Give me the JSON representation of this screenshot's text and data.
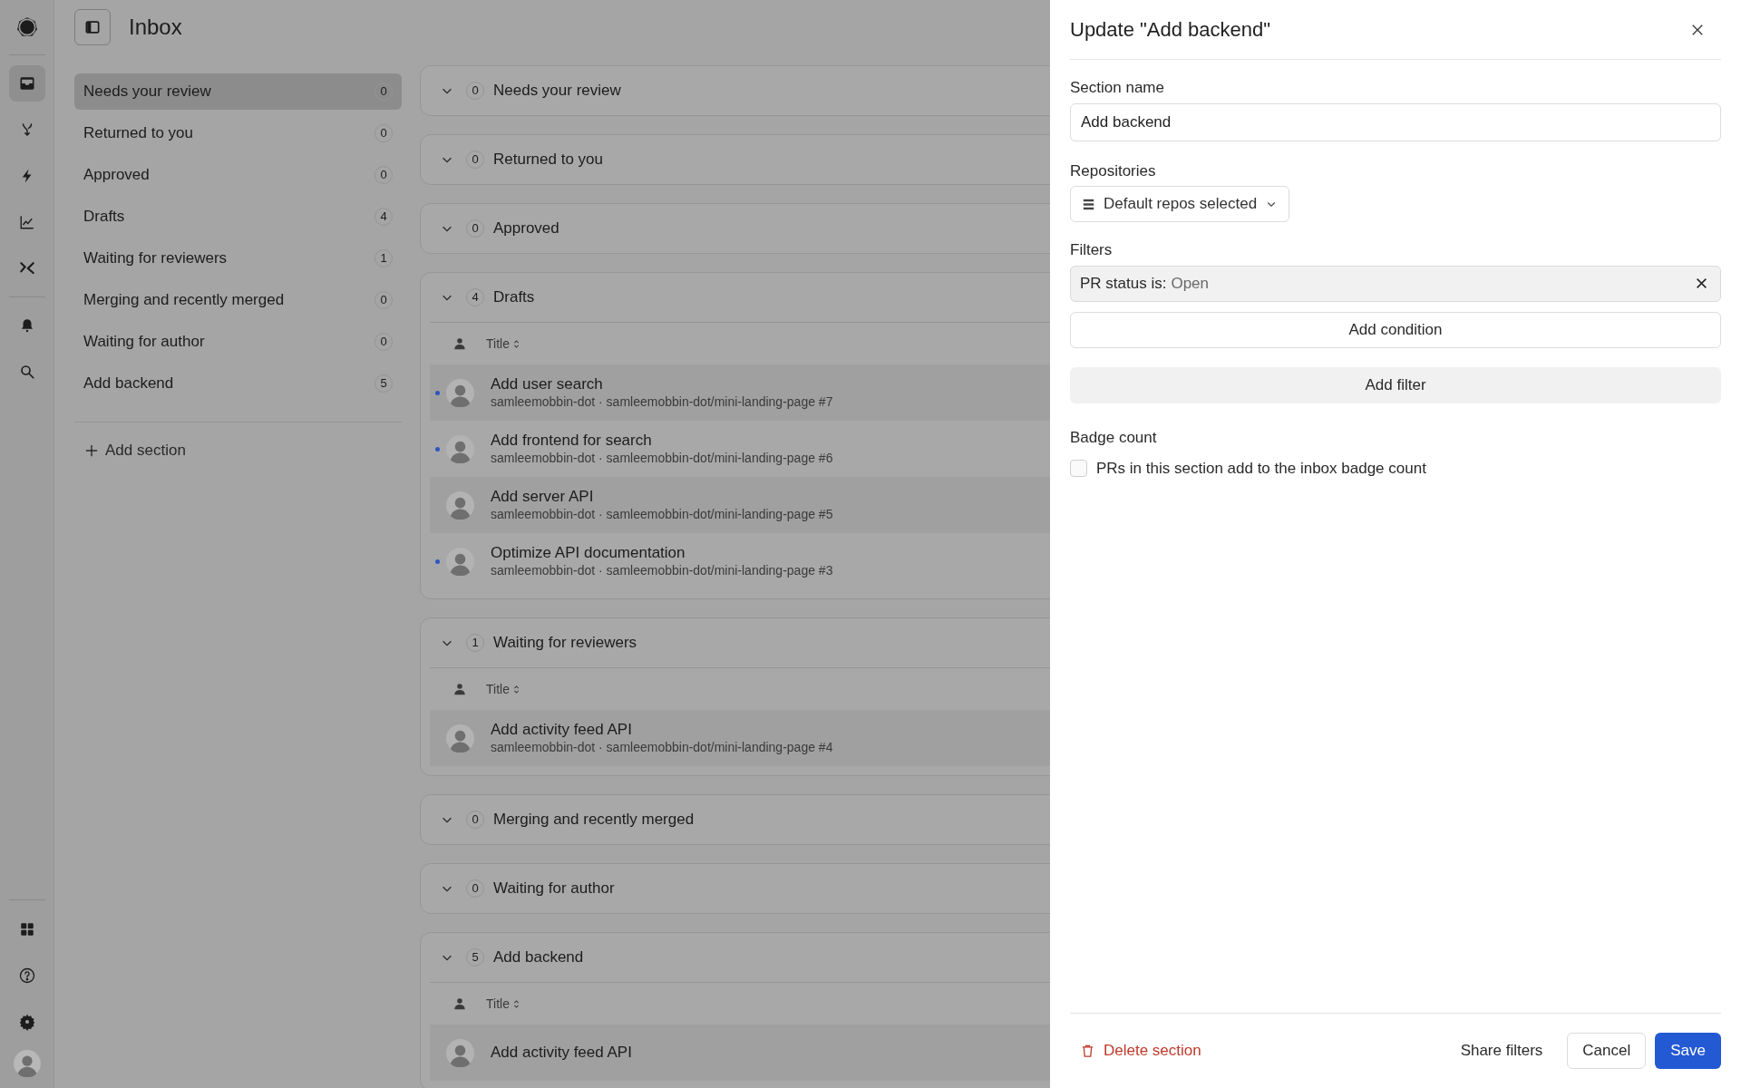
{
  "rail": {
    "top_items": [
      {
        "selected": true
      },
      {
        "selected": false
      },
      {
        "selected": false
      },
      {
        "selected": false
      },
      {
        "selected": false
      }
    ],
    "middle_items": [
      {
        "selected": false
      },
      {
        "selected": false
      }
    ],
    "bottom_items": [
      {
        "selected": false
      },
      {
        "selected": false
      },
      {
        "selected": false
      }
    ]
  },
  "header": {
    "title": "Inbox"
  },
  "sections": [
    {
      "label": "Needs your review",
      "count": "0",
      "selected": true
    },
    {
      "label": "Returned to you",
      "count": "0",
      "selected": false
    },
    {
      "label": "Approved",
      "count": "0",
      "selected": false
    },
    {
      "label": "Drafts",
      "count": "4",
      "selected": false
    },
    {
      "label": "Waiting for reviewers",
      "count": "1",
      "selected": false
    },
    {
      "label": "Merging and recently merged",
      "count": "0",
      "selected": false
    },
    {
      "label": "Waiting for author",
      "count": "0",
      "selected": false
    },
    {
      "label": "Add backend",
      "count": "5",
      "selected": false
    }
  ],
  "add_section": "Add section",
  "groups": [
    {
      "title": "Needs your review",
      "count": "0"
    },
    {
      "title": "Returned to you",
      "count": "0"
    },
    {
      "title": "Approved",
      "count": "0"
    },
    {
      "title": "Drafts",
      "count": "4",
      "column": "Title",
      "rows": [
        {
          "title": "Add user search",
          "subtitle": "samleemobbin-dot · samleemobbin-dot/mini-landing-page #7",
          "unread": true
        },
        {
          "title": "Add frontend for search",
          "subtitle": "samleemobbin-dot · samleemobbin-dot/mini-landing-page #6",
          "unread": true
        },
        {
          "title": "Add server API",
          "subtitle": "samleemobbin-dot · samleemobbin-dot/mini-landing-page #5",
          "unread": false
        },
        {
          "title": "Optimize API documentation",
          "subtitle": "samleemobbin-dot · samleemobbin-dot/mini-landing-page #3",
          "unread": true
        }
      ]
    },
    {
      "title": "Waiting for reviewers",
      "count": "1",
      "column": "Title",
      "rows": [
        {
          "title": "Add activity feed API",
          "subtitle": "samleemobbin-dot · samleemobbin-dot/mini-landing-page #4",
          "unread": false
        }
      ]
    },
    {
      "title": "Merging and recently merged",
      "count": "0"
    },
    {
      "title": "Waiting for author",
      "count": "0"
    },
    {
      "title": "Add backend",
      "count": "5",
      "column": "Title",
      "rows": [
        {
          "title": "Add activity feed API",
          "unread": false
        }
      ]
    }
  ],
  "drawer": {
    "title": "Update \"Add backend\"",
    "section_name": {
      "label": "Section name",
      "value": "Add backend"
    },
    "repositories": {
      "label": "Repositories",
      "value": "Default repos selected"
    },
    "filters": {
      "label": "Filters",
      "items": [
        {
          "field": "PR status is:",
          "value": "Open"
        }
      ],
      "add_condition": "Add condition",
      "add_filter": "Add filter"
    },
    "badge_count": {
      "label": "Badge count",
      "option": "PRs in this section add to the inbox badge count",
      "checked": false
    },
    "footer": {
      "delete": "Delete section",
      "share": "Share filters",
      "cancel": "Cancel",
      "save": "Save"
    }
  }
}
